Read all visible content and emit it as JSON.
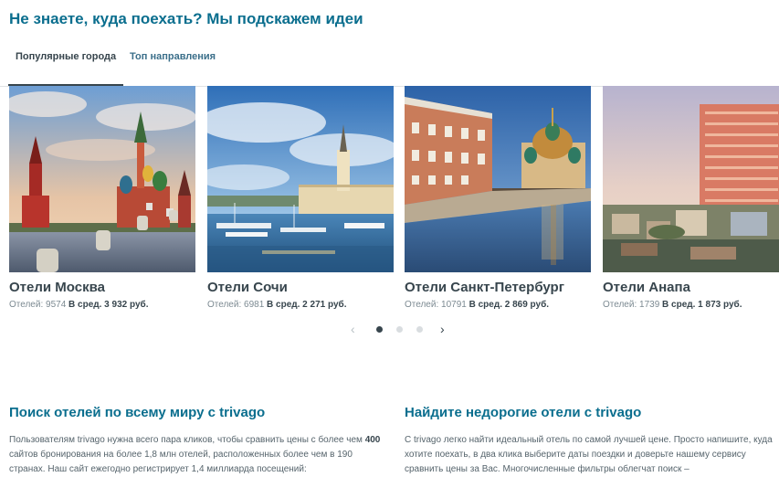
{
  "heading": "Не знаете, куда поехать? Мы подскажем идеи",
  "tabs": [
    {
      "label": "Популярные города",
      "active": true
    },
    {
      "label": "Топ направления",
      "active": false
    }
  ],
  "cards": [
    {
      "city": "Отели Москва",
      "hotels_label": "Отелей: 9574",
      "price_label": "В сред. 3 932 руб."
    },
    {
      "city": "Отели Сочи",
      "hotels_label": "Отелей: 6981",
      "price_label": "В сред. 2 271 руб."
    },
    {
      "city": "Отели Санкт-Петербург",
      "hotels_label": "Отелей: 10791",
      "price_label": "В сред. 2 869 руб."
    },
    {
      "city": "Отели Анапа",
      "hotels_label": "Отелей: 1739",
      "price_label": "В сред. 1 873 руб."
    }
  ],
  "carousel": {
    "prev": "‹",
    "next": "›",
    "page_count": 3,
    "active_page": 1
  },
  "sections": [
    {
      "title": "Поиск отелей по всему миру с trivago",
      "text_a": "Пользователям trivago нужна всего пара кликов, чтобы сравнить цены с более чем ",
      "text_bold": "400",
      "text_b": " сайтов бронирования на более 1,8 млн отелей, расположенных более чем в 190 странах. Наш сайт ежегодно регистрирует 1,4 миллиарда посещений:"
    },
    {
      "title": "Найдите недорогие отели с trivago",
      "text": "С trivago легко найти идеальный отель по самой лучшей цене. Просто напишите, куда хотите поехать, в два клика выберите даты поездки и доверьте нашему сервису сравнить цены за Вас. Многочисленные фильтры облегчат поиск –"
    }
  ],
  "colors": {
    "heading": "#0a6e8e",
    "text": "#37454d",
    "muted": "#7c8a92",
    "divider": "#dfe2e5"
  }
}
